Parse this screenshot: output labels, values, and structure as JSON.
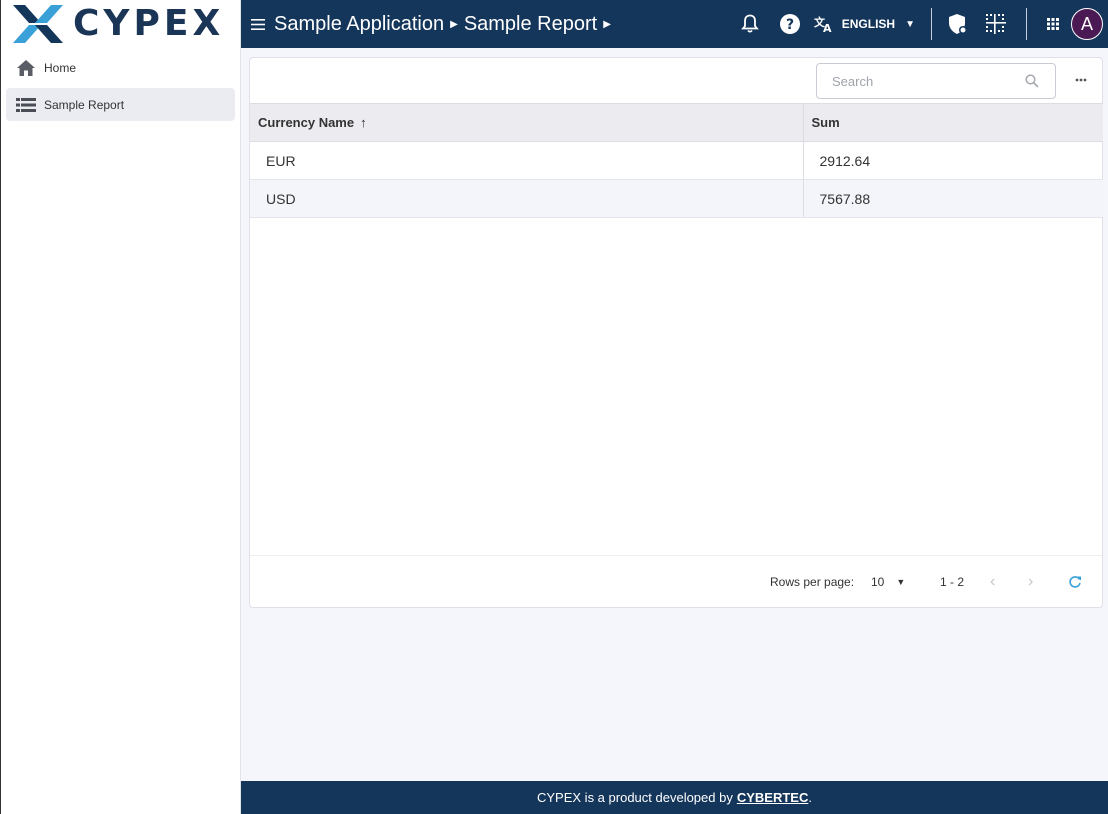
{
  "brand": {
    "logo_text": "CYPEX",
    "accent": "#3aa0d8",
    "primary": "#15365b"
  },
  "sidebar": {
    "items": [
      {
        "label": "Home",
        "icon": "home-icon",
        "active": false
      },
      {
        "label": "Sample Report",
        "icon": "list-icon",
        "active": true
      }
    ]
  },
  "header": {
    "breadcrumbs": [
      "Sample Application",
      "Sample Report"
    ],
    "language": "ENGLISH",
    "avatar_initial": "A"
  },
  "table": {
    "search_placeholder": "Search",
    "columns": [
      "Currency Name",
      "Sum"
    ],
    "sorted_column": "Currency Name",
    "sort_direction": "ascending",
    "rows": [
      [
        "EUR",
        "2912.64"
      ],
      [
        "USD",
        "7567.88"
      ]
    ],
    "pagination": {
      "rows_per_page_label": "Rows per page:",
      "rows_per_page": "10",
      "range": "1 - 2"
    }
  },
  "footer": {
    "text": "CYPEX is a product developed by",
    "link": "CYBERTEC",
    "suffix": "."
  }
}
